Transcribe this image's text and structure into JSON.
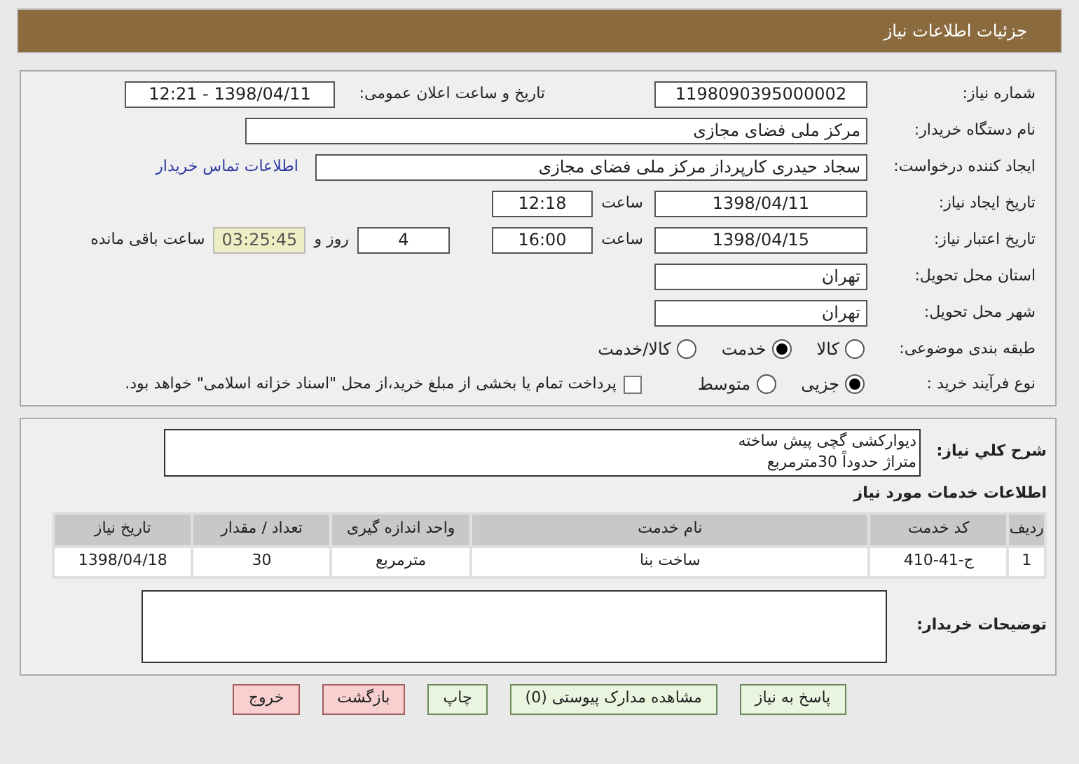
{
  "header": {
    "title": "جزئیات اطلاعات نیاز"
  },
  "need_number": {
    "label": "شماره نیاز:",
    "value": "1198090395000002"
  },
  "announce": {
    "label": "تاریخ و ساعت اعلان عمومی:",
    "value": "1398/04/11 - 12:21"
  },
  "buyer_org": {
    "label": "نام دستگاه خریدار:",
    "value": "مرکز ملی فضای مجازی"
  },
  "creator": {
    "label": "ایجاد کننده درخواست:",
    "value": "سجاد حیدری کارپرداز مرکز ملی فضای مجازی",
    "link": "اطلاعات تماس خریدار"
  },
  "created": {
    "label": "تاریخ ایجاد نیاز:",
    "date": "1398/04/11",
    "time_label": "ساعت",
    "time": "12:18"
  },
  "validity": {
    "label": "تاریخ اعتبار نیاز:",
    "date": "1398/04/15",
    "time_label": "ساعت",
    "time": "16:00",
    "days": "4",
    "days_label": "روز و",
    "remaining": "03:25:45",
    "remaining_label": "ساعت باقی مانده"
  },
  "province": {
    "label": "استان محل تحویل:",
    "value": "تهران"
  },
  "city": {
    "label": "شهر محل تحویل:",
    "value": "تهران"
  },
  "category": {
    "label": "طبقه بندی موضوعی:",
    "options": [
      {
        "label": "کالا",
        "selected": false
      },
      {
        "label": "خدمت",
        "selected": true
      },
      {
        "label": "کالا/خدمت",
        "selected": false
      }
    ]
  },
  "process": {
    "label": "نوع فرآیند خرید :",
    "options": [
      {
        "label": "جزیی",
        "selected": true
      },
      {
        "label": "متوسط",
        "selected": false
      }
    ],
    "treasury": {
      "label": "پرداخت تمام یا بخشی از مبلغ خرید،از محل \"اسناد خزانه اسلامی\" خواهد بود.",
      "checked": false
    }
  },
  "description": {
    "label": "شرح کلي نياز:",
    "lines": [
      "دیوارکشی گچی پیش ساخته",
      "متراژ حدوداً 30مترمربع"
    ]
  },
  "services": {
    "title": "اطلاعات خدمات مورد نیاز",
    "columns": [
      "ردیف",
      "کد خدمت",
      "نام خدمت",
      "واحد اندازه گیری",
      "تعداد / مقدار",
      "تاریخ نیاز"
    ],
    "rows": [
      [
        "1",
        "ج-41-410",
        "ساخت بنا",
        "مترمربع",
        "30",
        "1398/04/18"
      ]
    ]
  },
  "buyer_notes": {
    "label": "توضیحات خریدار:"
  },
  "buttons": [
    {
      "label": "پاسخ به نیاز",
      "kind": "go"
    },
    {
      "label": "مشاهده مدارک پیوستی (0)",
      "kind": "go"
    },
    {
      "label": "چاپ",
      "kind": "go"
    },
    {
      "label": "بازگشت",
      "kind": "stop"
    },
    {
      "label": "خروج",
      "kind": "stop"
    }
  ]
}
